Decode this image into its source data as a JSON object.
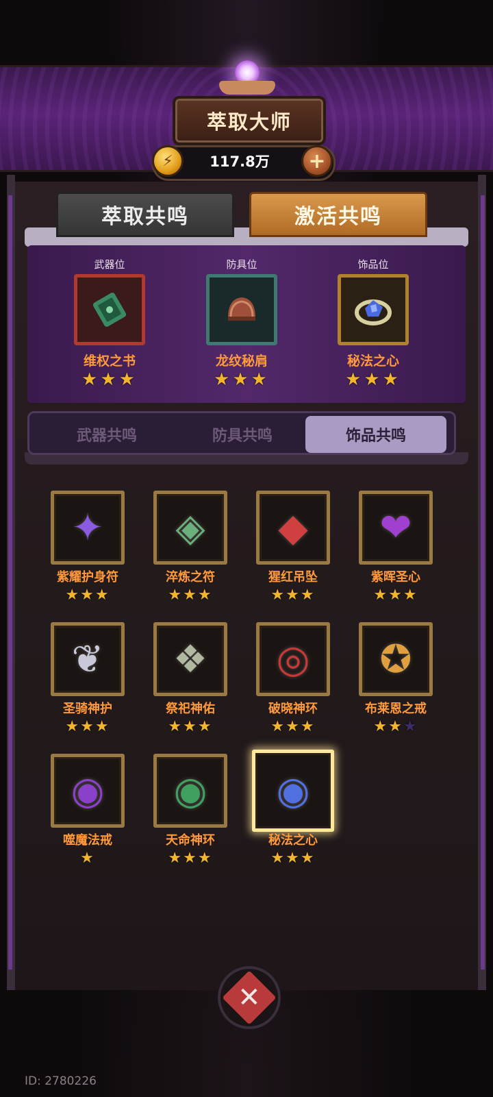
{
  "header": {
    "title": "萃取大师",
    "currency_value": "117.8万",
    "coin_icon": "⚡",
    "add_icon": "+"
  },
  "main_tabs": [
    {
      "label": "萃取共鸣",
      "active": false
    },
    {
      "label": "激活共鸣",
      "active": true
    }
  ],
  "slots": [
    {
      "caption": "武器位",
      "name": "维权之书",
      "stars": "★★★",
      "border": "#b03a2e",
      "icon": "green-book-icon"
    },
    {
      "caption": "防具位",
      "name": "龙纹秘肩",
      "stars": "★★★",
      "border": "#3f7a72",
      "icon": "shoulder-armor-icon"
    },
    {
      "caption": "饰品位",
      "name": "秘法之心",
      "stars": "★★★",
      "border": "#b0822e",
      "icon": "blue-ring-icon"
    }
  ],
  "sub_tabs": [
    {
      "label": "武器共鸣",
      "active": false
    },
    {
      "label": "防具共鸣",
      "active": false
    },
    {
      "label": "饰品共鸣",
      "active": true
    }
  ],
  "items": [
    {
      "name": "紫耀护身符",
      "stars": 3,
      "icon": "purple-amulet-icon",
      "glyph": "✦",
      "color": "#8a5ae0"
    },
    {
      "name": "淬炼之符",
      "stars": 3,
      "icon": "green-amulet-icon",
      "glyph": "◈",
      "color": "#6ab07a"
    },
    {
      "name": "猩红吊坠",
      "stars": 3,
      "icon": "red-pendant-icon",
      "glyph": "◆",
      "color": "#d04040"
    },
    {
      "name": "紫晖圣心",
      "stars": 3,
      "icon": "violet-heart-icon",
      "glyph": "❤",
      "color": "#a040d0"
    },
    {
      "name": "圣骑神护",
      "stars": 3,
      "icon": "wing-collar-icon",
      "glyph": "❦",
      "color": "#c8c8d8"
    },
    {
      "name": "祭祀神佑",
      "stars": 3,
      "icon": "ritual-necklace-icon",
      "glyph": "❖",
      "color": "#b0b8a0"
    },
    {
      "name": "破晓神环",
      "stars": 3,
      "icon": "red-bracelet-icon",
      "glyph": "◎",
      "color": "#c83838"
    },
    {
      "name": "布莱恩之戒",
      "stars": 2,
      "icon": "star-ring-icon",
      "glyph": "✪",
      "color": "#e0a040"
    },
    {
      "name": "噬魔法戒",
      "stars": 1,
      "icon": "purple-ring-icon",
      "glyph": "◉",
      "color": "#8a40c8"
    },
    {
      "name": "天命神环",
      "stars": 3,
      "icon": "emerald-ring-icon",
      "glyph": "◉",
      "color": "#40a060"
    },
    {
      "name": "秘法之心",
      "stars": 3,
      "icon": "blue-ring-icon",
      "glyph": "◉",
      "color": "#5070e0",
      "selected": true
    }
  ],
  "footer": {
    "id_text": "ID: 2780226",
    "emblem_glyph": "✕"
  },
  "colors": {
    "accent_orange": "#ff9a3c",
    "star_gold": "#f3b52c",
    "star_empty": "#3a2e6a",
    "banner_purple": "#5a2478"
  }
}
